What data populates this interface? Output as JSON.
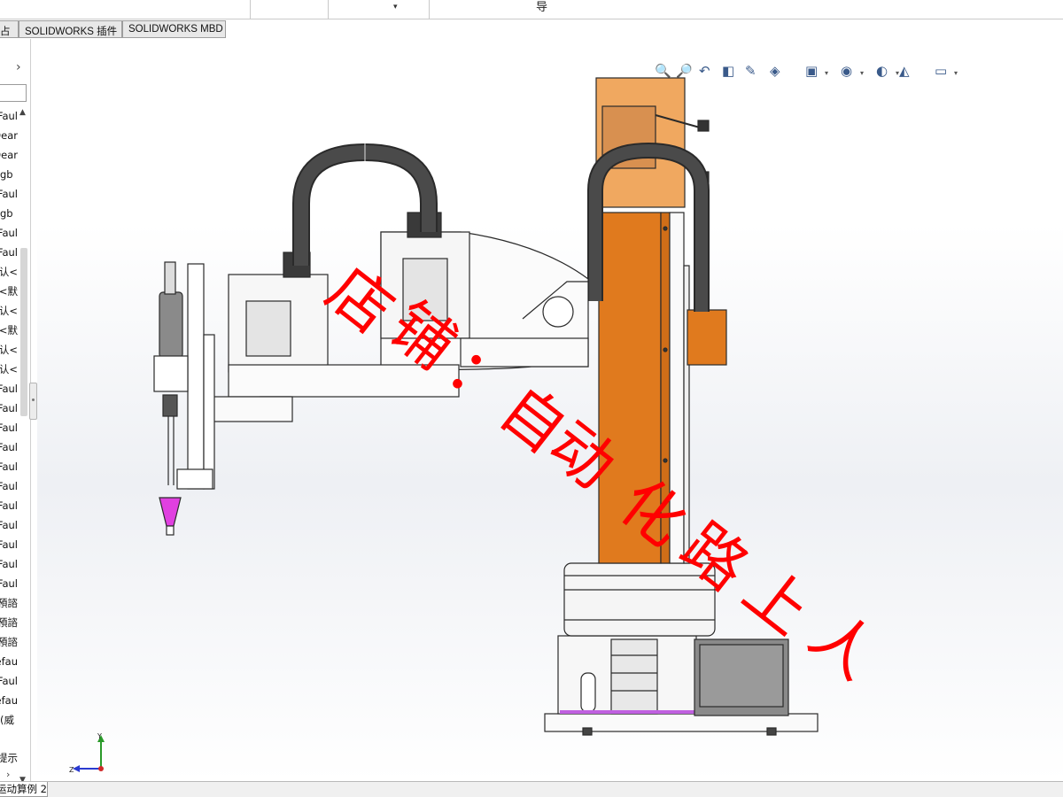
{
  "ribbon": {
    "dropdown_caret": "▾",
    "partial_label": "导"
  },
  "command_tabs": [
    {
      "label": "占"
    },
    {
      "label": "SOLIDWORKS 插件"
    },
    {
      "label": "SOLIDWORKS MBD"
    }
  ],
  "feature_tree": {
    "expand_arrow": "›",
    "items": [
      "Faul",
      "Dear",
      "Dear",
      "gb",
      "Faul",
      "gb",
      "Faul",
      "Faul",
      "认<",
      "<默",
      "认<",
      "<默",
      "认<",
      "认<",
      "Faul",
      "Faul",
      "Faul",
      "Faul",
      "Faul",
      "Faul",
      "Faul",
      "Faul",
      "Faul",
      "Faul",
      "Faul",
      "預諮",
      "預諮",
      "預諮",
      "efau",
      "Faul",
      "efau",
      "(威"
    ],
    "bottom_item": "提示",
    "bottom_arrow": "›"
  },
  "heads_up_toolbar": {
    "icons": [
      "zoom-to-fit-icon",
      "zoom-to-area-icon",
      "previous-view-icon",
      "section-view-icon",
      "dynamic-annotation-icon",
      "view-orientation-icon",
      "display-style-icon",
      "hide-show-items-icon",
      "edit-appearance-icon",
      "apply-scene-icon",
      "view-settings-icon"
    ]
  },
  "triad": {
    "y_label": "Y",
    "z_label": "Z"
  },
  "watermark": {
    "text": "店铺：自动化路上人",
    "color": "#ff0000"
  },
  "model_colors": {
    "orange": "#e07a1e",
    "orange_light": "#f0a860",
    "cable": "#4a4a4a",
    "magenta": "#e040e0",
    "outline": "#2a2a2a"
  },
  "bottom_tabs": [
    {
      "label": "运动算例 2"
    }
  ]
}
